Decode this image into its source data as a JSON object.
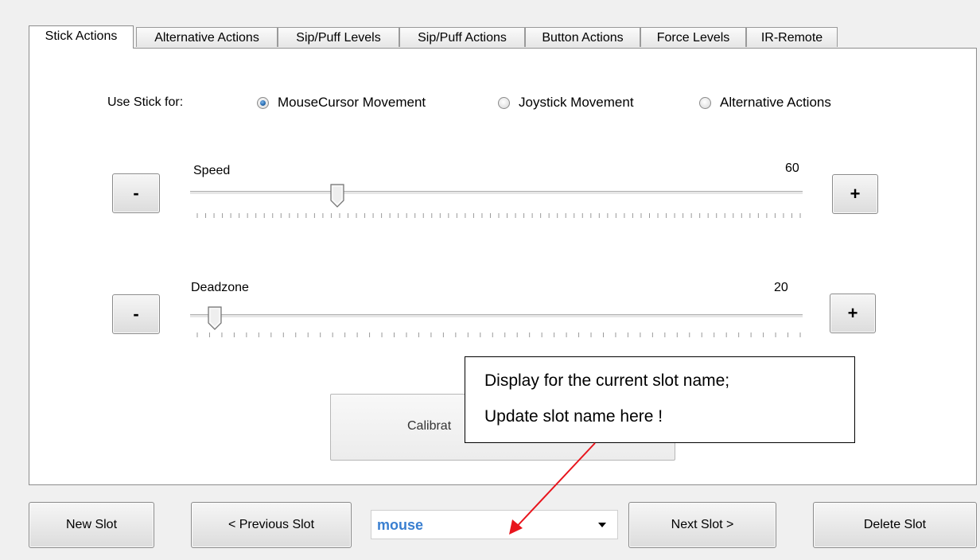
{
  "tabs": [
    {
      "label": "Stick Actions",
      "active": true
    },
    {
      "label": "Alternative Actions",
      "active": false
    },
    {
      "label": "Sip/Puff Levels",
      "active": false
    },
    {
      "label": "Sip/Puff Actions",
      "active": false
    },
    {
      "label": "Button Actions",
      "active": false
    },
    {
      "label": "Force Levels",
      "active": false
    },
    {
      "label": "IR-Remote",
      "active": false
    }
  ],
  "stick_mode": {
    "label": "Use Stick for:",
    "options": [
      {
        "label": "MouseCursor Movement",
        "checked": true
      },
      {
        "label": "Joystick Movement",
        "checked": false
      },
      {
        "label": "Alternative Actions",
        "checked": false
      }
    ]
  },
  "speed": {
    "label": "Speed",
    "value": "60",
    "minus_label": "-",
    "plus_label": "+",
    "level": 0.24
  },
  "deadzone": {
    "label": "Deadzone",
    "value": "20",
    "minus_label": "-",
    "plus_label": "+",
    "level": 0.04
  },
  "calibrate": {
    "visible_text": "Calibrat"
  },
  "bottom": {
    "new_slot": "New Slot",
    "previous_slot": "< Previous Slot",
    "slot_name": "mouse",
    "next_slot": "Next  Slot >",
    "delete_slot": "Delete Slot"
  },
  "callout": {
    "line1": "Display for the current slot name;",
    "line2": "Update slot name here !"
  },
  "colors": {
    "arrow": "#e8141c",
    "slot_text": "#3a7fd0",
    "radio_selected": "#2a6fb5"
  }
}
